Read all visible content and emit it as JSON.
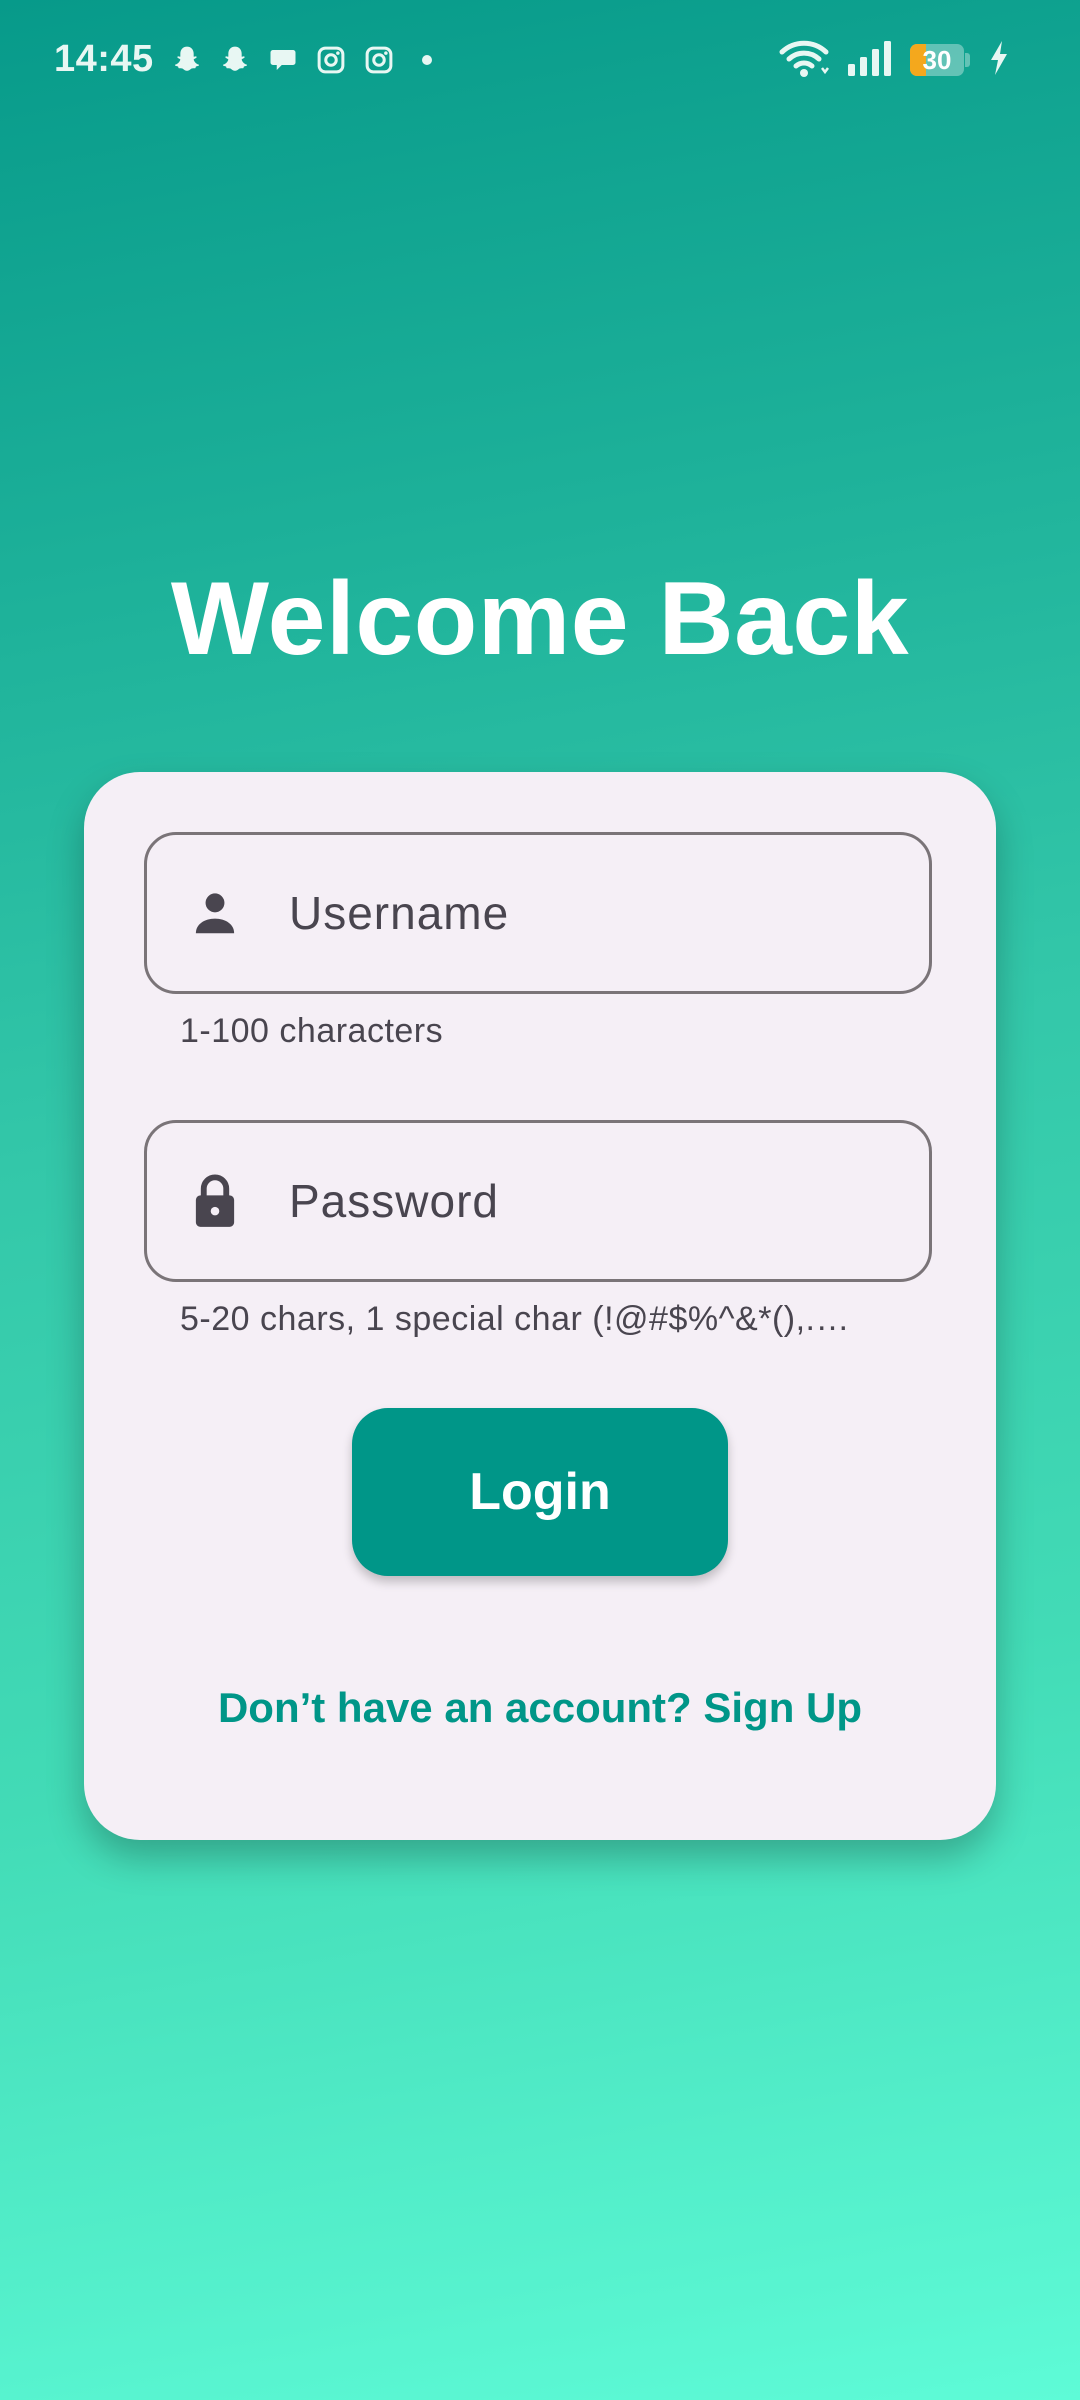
{
  "status_bar": {
    "time": "14:45",
    "battery_level": "30",
    "battery_fraction": 0.3,
    "notification_icons": [
      "snapchat-icon",
      "snapchat-icon",
      "chat-bubble-icon",
      "instagram-icon",
      "instagram-icon",
      "more-dot-icon"
    ],
    "right_icons": [
      "wifi-icon",
      "signal-icon",
      "battery-icon",
      "charging-icon"
    ]
  },
  "title": "Welcome Back",
  "form": {
    "username": {
      "placeholder": "Username",
      "value": "",
      "helper": "1-100 characters",
      "icon": "person-icon"
    },
    "password": {
      "placeholder": "Password",
      "value": "",
      "helper": "5-20 chars, 1 special char (!@#$%^&*(),.…",
      "icon": "lock-icon"
    },
    "login_label": "Login",
    "signup_text": "Don’t have an account? Sign Up"
  },
  "colors": {
    "accent": "#009688",
    "card_background": "#f5eff6",
    "gradient_top": "#079a8a",
    "gradient_bottom": "#5efbd7",
    "battery": "#f4a81d"
  }
}
